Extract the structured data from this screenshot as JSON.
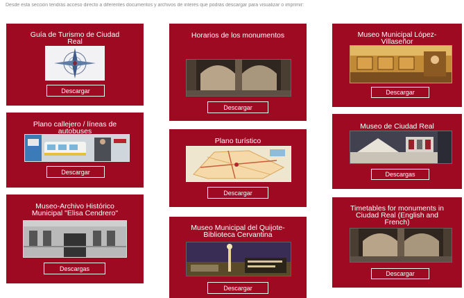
{
  "intro_text": "Desde esta sección tendrás acceso directo a diferentes documentos y archivos de interés que podrás descargar para visualizar o imprimir:",
  "cards": [
    {
      "title": "Guía de Turismo de Ciudad Real",
      "button": "Descargar",
      "thumb": "tourism-guide-compass-image"
    },
    {
      "title": "Plano callejero / líneas de autobuses",
      "button": "Descargar",
      "thumb": "bus-street-map-image"
    },
    {
      "title": "Museo-Archivo Histórico Municipal \"Elisa Cendrero\"",
      "button": "Descargas",
      "thumb": "museum-building-facade-image"
    },
    {
      "title": "Horarios de los monumentos",
      "button": "Descargar",
      "thumb": "cathedral-interior-image"
    },
    {
      "title": "Plano turístico",
      "button": "Descargar",
      "thumb": "tourist-map-image"
    },
    {
      "title": "Museo Municipal del Quijote-Biblioteca Cervantina",
      "button": "Descargar",
      "thumb": "quijote-museum-image"
    },
    {
      "title": "Museo Municipal López-Villaseñor",
      "button": "Descargar",
      "thumb": "painting-gallery-image"
    },
    {
      "title": "Museo de Ciudad Real",
      "button": "Descargas",
      "thumb": "museum-hall-image"
    },
    {
      "title": "Timetables for monuments in Ciudad Real (English and French)",
      "button": "Descargar",
      "thumb": "cathedral-interior-image"
    }
  ],
  "colors": {
    "card_bg": "#9e0a21",
    "text": "#ffffff"
  }
}
